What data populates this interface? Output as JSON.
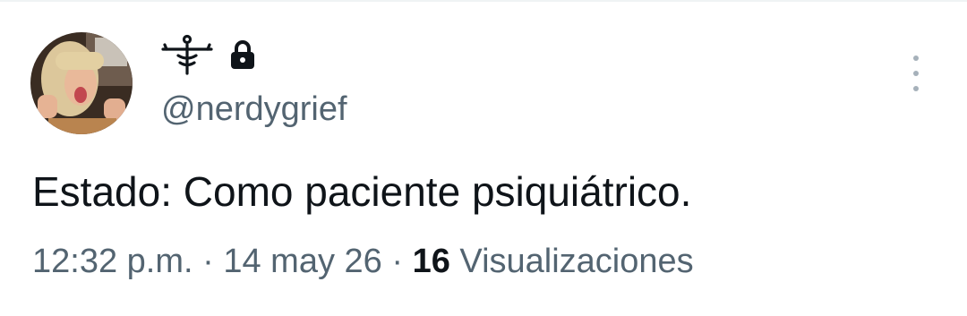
{
  "tweet": {
    "handle": "@nerdygrief",
    "text": "Estado: Como paciente psiquiátrico.",
    "time": "12:32 p.m.",
    "separator": "·",
    "date": "14 may 26",
    "views_count": "16",
    "views_label": "Visualizaciones"
  },
  "icons": {
    "display_name": "symbol-glyph-icon",
    "protected": "lock-icon",
    "menu": "more-vertical-icon"
  },
  "colors": {
    "text": "#0f1419",
    "secondary": "#536471",
    "menu_dots": "#a6b1ba"
  }
}
